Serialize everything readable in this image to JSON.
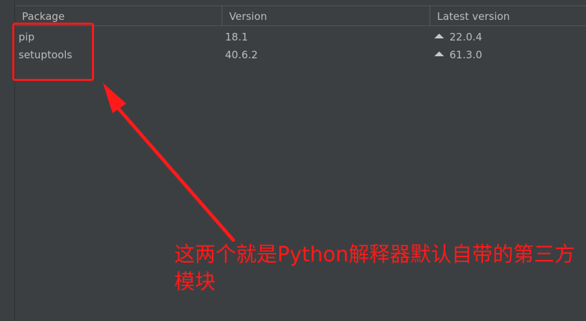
{
  "table": {
    "columns": [
      "Package",
      "Version",
      "Latest version"
    ],
    "rows": [
      {
        "package": "pip",
        "version": "18.1",
        "latest": "22.0.4"
      },
      {
        "package": "setuptools",
        "version": "40.6.2",
        "latest": "61.3.0"
      }
    ]
  },
  "annotation": {
    "text": "这两个就是Python解释器默认自带的第三方模块",
    "color": "#ff1a1a"
  },
  "icons": {
    "upgrade": "upgrade-available-icon"
  }
}
